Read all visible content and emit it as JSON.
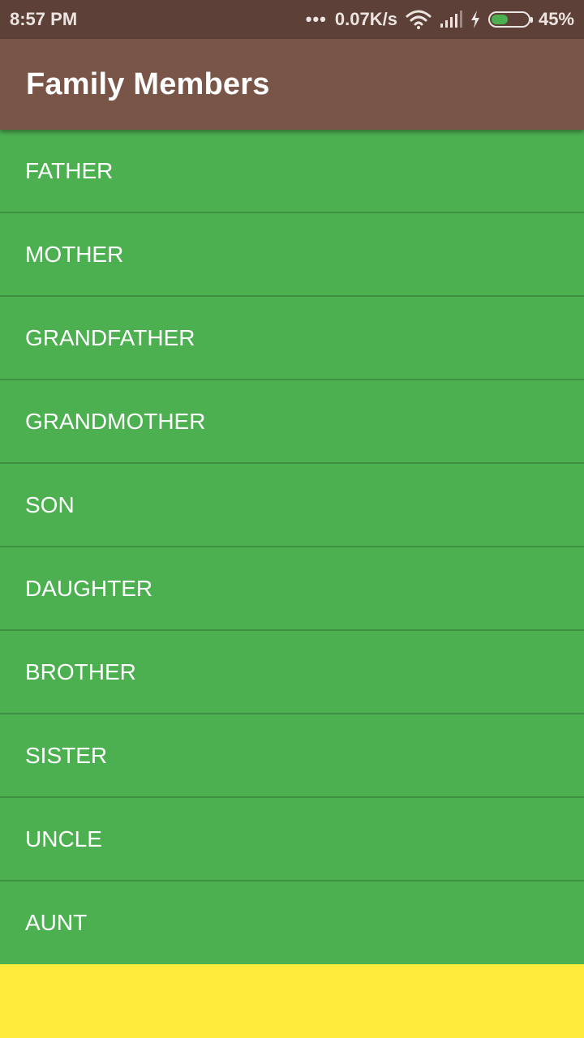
{
  "status_bar": {
    "time": "8:57 PM",
    "dots": "•••",
    "network_speed": "0.07K/s",
    "battery_percent": "45%",
    "battery_level": 0.45,
    "icons": [
      "wifi-icon",
      "signal-icon",
      "charging-icon",
      "battery-icon"
    ],
    "background_color": "#5D4037"
  },
  "app_bar": {
    "title": "Family Members",
    "background_color": "#795548"
  },
  "list": {
    "background_color": "#4CAF50",
    "items": [
      {
        "label": "FATHER"
      },
      {
        "label": "MOTHER"
      },
      {
        "label": "GRANDFATHER"
      },
      {
        "label": "GRANDMOTHER"
      },
      {
        "label": "SON"
      },
      {
        "label": "DAUGHTER"
      },
      {
        "label": "BROTHER"
      },
      {
        "label": "SISTER"
      },
      {
        "label": "UNCLE"
      },
      {
        "label": "AUNT"
      }
    ]
  },
  "page": {
    "background_color": "#FFEB3B"
  }
}
